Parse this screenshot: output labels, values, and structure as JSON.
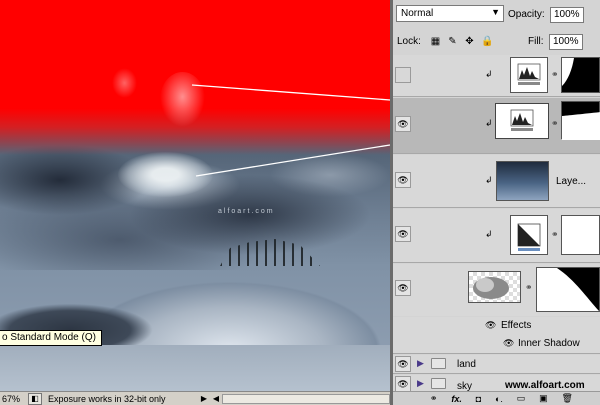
{
  "canvas": {
    "watermark": "alfoart.com",
    "tooltip": "o Standard Mode (Q)"
  },
  "status": {
    "zoom": "67%",
    "message": "Exposure works in 32-bit only",
    "left_arrow": "◀",
    "right_arrow": "▶"
  },
  "panel": {
    "blend_mode": "Normal",
    "opacity_label": "Opacity:",
    "opacity_value": "100%",
    "lock_label": "Lock:",
    "fill_label": "Fill:",
    "fill_value": "100%",
    "layers": [
      {
        "name": "",
        "visible": false,
        "selected": false,
        "type": "levels-adjustment"
      },
      {
        "name": "",
        "visible": true,
        "selected": true,
        "type": "levels-adjustment"
      },
      {
        "name": "Laye...",
        "visible": true,
        "selected": false,
        "type": "image"
      },
      {
        "name": "",
        "visible": true,
        "selected": false,
        "type": "gradient-adjustment"
      },
      {
        "name": "",
        "visible": true,
        "selected": false,
        "type": "cloud-with-mask"
      }
    ],
    "effects_label": "Effects",
    "inner_shadow_label": "Inner Shadow",
    "groups": [
      {
        "name": "land"
      },
      {
        "name": "sky"
      }
    ],
    "site": "www.alfoart.com",
    "bottom_icons": [
      "link-icon",
      "fx-icon",
      "mask-icon",
      "adjustment-icon",
      "group-icon",
      "new-layer-icon",
      "trash-icon"
    ],
    "bottom_glyphs": [
      "⚭",
      "fx.",
      "◘",
      "◐.",
      "▭",
      "▣",
      "🗑"
    ]
  }
}
